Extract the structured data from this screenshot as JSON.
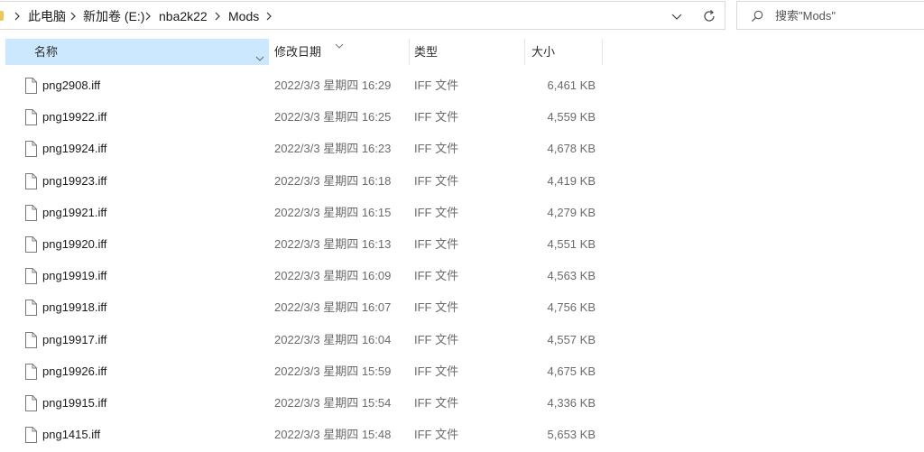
{
  "breadcrumb": {
    "items": [
      "此电脑",
      "新加卷 (E:)",
      "nba2k22",
      "Mods"
    ]
  },
  "search": {
    "placeholder": "搜索\"Mods\""
  },
  "columns": {
    "name": "名称",
    "date": "修改日期",
    "type": "类型",
    "size": "大小"
  },
  "files": [
    {
      "name": "png2908.iff",
      "date": "2022/3/3 星期四 16:29",
      "type": "IFF 文件",
      "size": "6,461 KB"
    },
    {
      "name": "png19922.iff",
      "date": "2022/3/3 星期四 16:25",
      "type": "IFF 文件",
      "size": "4,559 KB"
    },
    {
      "name": "png19924.iff",
      "date": "2022/3/3 星期四 16:23",
      "type": "IFF 文件",
      "size": "4,678 KB"
    },
    {
      "name": "png19923.iff",
      "date": "2022/3/3 星期四 16:18",
      "type": "IFF 文件",
      "size": "4,419 KB"
    },
    {
      "name": "png19921.iff",
      "date": "2022/3/3 星期四 16:15",
      "type": "IFF 文件",
      "size": "4,279 KB"
    },
    {
      "name": "png19920.iff",
      "date": "2022/3/3 星期四 16:13",
      "type": "IFF 文件",
      "size": "4,551 KB"
    },
    {
      "name": "png19919.iff",
      "date": "2022/3/3 星期四 16:09",
      "type": "IFF 文件",
      "size": "4,563 KB"
    },
    {
      "name": "png19918.iff",
      "date": "2022/3/3 星期四 16:07",
      "type": "IFF 文件",
      "size": "4,756 KB"
    },
    {
      "name": "png19917.iff",
      "date": "2022/3/3 星期四 16:04",
      "type": "IFF 文件",
      "size": "4,557 KB"
    },
    {
      "name": "png19926.iff",
      "date": "2022/3/3 星期四 15:59",
      "type": "IFF 文件",
      "size": "4,675 KB"
    },
    {
      "name": "png19915.iff",
      "date": "2022/3/3 星期四 15:54",
      "type": "IFF 文件",
      "size": "4,336 KB"
    },
    {
      "name": "png1415.iff",
      "date": "2022/3/3 星期四 15:48",
      "type": "IFF 文件",
      "size": "5,653 KB"
    }
  ],
  "colors": {
    "header_selected": "#cce8ff",
    "folder": "#f2c55c"
  },
  "icons": {
    "folder": "folder-icon",
    "file": "file-icon",
    "search": "search-icon",
    "refresh": "refresh-icon",
    "dropdown": "chevron-down-icon",
    "separator": "chevron-right-icon"
  }
}
